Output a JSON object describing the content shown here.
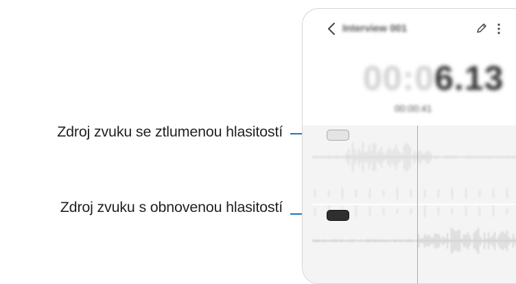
{
  "callouts": {
    "muted_label": "Zdroj zvuku se ztlumenou hlasitostí",
    "restored_label": "Zdroj zvuku s obnovenou hlasitostí",
    "line_color": "#1e73b9"
  },
  "phone": {
    "title": "Interview 001",
    "timer": {
      "dim_digits": "00:0",
      "main_digits": "6.13"
    },
    "subtime": "00:00:41",
    "icons": {
      "back": "chevron-left-icon",
      "edit": "pencil-icon",
      "more": "more-vertical-icon"
    },
    "tracks": {
      "muted": {
        "state": "muted",
        "color": "#e4e4e4"
      },
      "restored": {
        "state": "restored",
        "color": "#2f2f2f"
      }
    },
    "playhead_color": "#f08a8a"
  }
}
